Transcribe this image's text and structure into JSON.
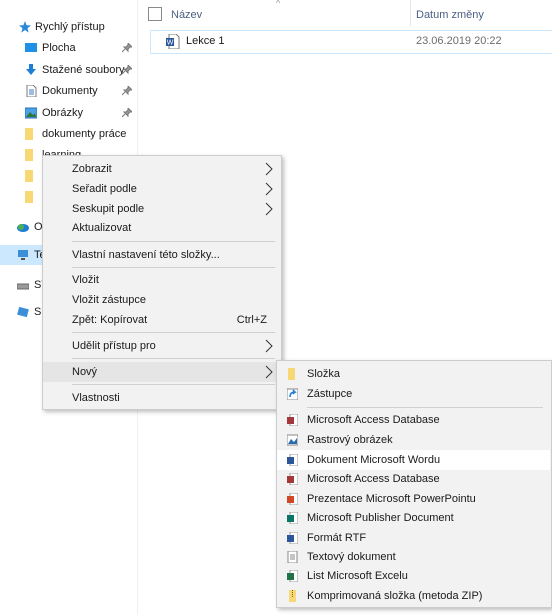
{
  "nav": {
    "quick_access": "Rychlý přístup",
    "items": [
      {
        "label": "Plocha",
        "icon": "desktop-icon",
        "pinned": true
      },
      {
        "label": "Stažené soubory",
        "icon": "downloads-icon",
        "pinned": true
      },
      {
        "label": "Dokumenty",
        "icon": "documents-icon",
        "pinned": true
      },
      {
        "label": "Obrázky",
        "icon": "pictures-icon",
        "pinned": true
      },
      {
        "label": "dokumenty práce",
        "icon": "folder-icon",
        "pinned": false
      }
    ],
    "partial": [
      "learning",
      "O",
      "Te",
      "ST",
      "Sí"
    ]
  },
  "header": {
    "col_name": "Název",
    "col_date": "Datum změny"
  },
  "files": [
    {
      "name": "Lekce 1",
      "date": "23.06.2019 20:22",
      "icon": "word-file-icon"
    }
  ],
  "context_menu": {
    "items": [
      {
        "label": "Zobrazit",
        "submenu": true
      },
      {
        "label": "Seřadit podle",
        "submenu": true
      },
      {
        "label": "Seskupit podle",
        "submenu": true
      },
      {
        "label": "Aktualizovat"
      },
      {
        "label": "Vlastní nastavení této složky..."
      },
      {
        "label": "Vložit"
      },
      {
        "label": "Vložit zástupce"
      },
      {
        "label": "Zpět: Kopírovat",
        "shortcut": "Ctrl+Z"
      },
      {
        "label": "Udělit přístup pro",
        "submenu": true
      },
      {
        "label": "Nový",
        "submenu": true
      },
      {
        "label": "Vlastnosti"
      }
    ]
  },
  "new_submenu": {
    "items": [
      {
        "label": "Složka",
        "icon": "folder-icon"
      },
      {
        "label": "Zástupce",
        "icon": "shortcut-icon"
      },
      {
        "label": "Microsoft Access Database",
        "icon": "access-icon"
      },
      {
        "label": "Rastrový obrázek",
        "icon": "bitmap-icon"
      },
      {
        "label": "Dokument Microsoft Wordu",
        "icon": "word-icon"
      },
      {
        "label": "Microsoft Access Database",
        "icon": "access-icon"
      },
      {
        "label": "Prezentace Microsoft PowerPointu",
        "icon": "powerpoint-icon"
      },
      {
        "label": "Microsoft Publisher Document",
        "icon": "publisher-icon"
      },
      {
        "label": "Formát RTF",
        "icon": "rtf-icon"
      },
      {
        "label": "Textový dokument",
        "icon": "text-icon"
      },
      {
        "label": "List Microsoft Excelu",
        "icon": "excel-icon"
      },
      {
        "label": "Komprimovaná složka (metoda ZIP)",
        "icon": "zip-icon"
      }
    ]
  },
  "colors": {
    "accent": "#0078d7",
    "folder": "#f8d775",
    "selection_border": "#cce8ff"
  }
}
